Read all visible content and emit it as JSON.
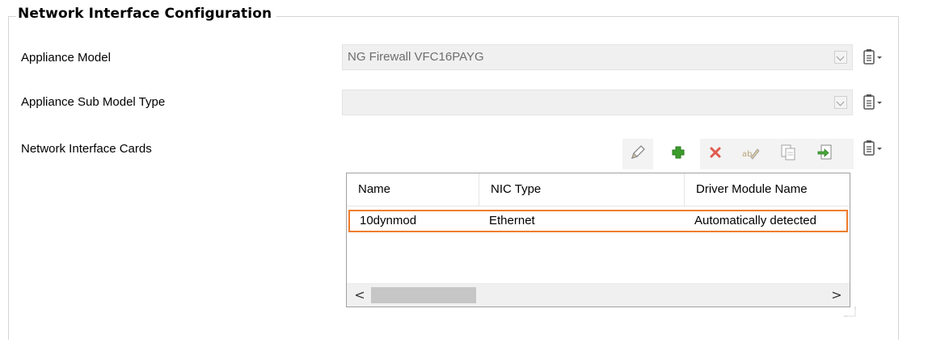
{
  "group": {
    "title": "Network Interface Configuration"
  },
  "fields": {
    "appliance_model": {
      "label": "Appliance Model",
      "value": "NG Firewall VFC16PAYG"
    },
    "sub_model_type": {
      "label": "Appliance Sub Model Type",
      "value": ""
    },
    "nic": {
      "label": "Network Interface Cards"
    }
  },
  "toolbar": {
    "buttons": [
      "pencil-icon",
      "add-icon",
      "delete-icon",
      "rename-icon",
      "copy-icon",
      "import-icon"
    ]
  },
  "grid": {
    "columns": [
      "Name",
      "NIC Type",
      "Driver Module Name"
    ],
    "rows": [
      {
        "name": "10dynmod",
        "nic_type": "Ethernet",
        "driver": "Automatically detected"
      }
    ],
    "scroll_left": "<",
    "scroll_right": ">"
  },
  "colors": {
    "highlight_border": "#ef7d2d",
    "add_icon": "#3b9c2b",
    "delete_icon": "#e05a4f"
  }
}
